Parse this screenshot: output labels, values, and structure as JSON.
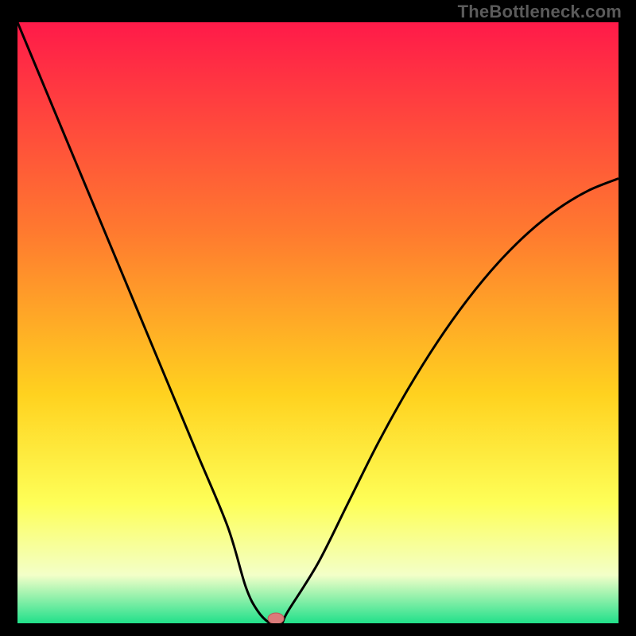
{
  "watermark": "TheBottleneck.com",
  "colors": {
    "frame_bg": "#000000",
    "curve": "#000000",
    "marker_fill": "#da7b7a",
    "marker_stroke": "#b85a59",
    "grad_top": "#ff1a49",
    "grad_mid1": "#ff6a2f",
    "grad_mid2": "#ffd21f",
    "grad_mid3": "#feff58",
    "grad_mid4": "#f6ffb0",
    "grad_bottom": "#21e08a"
  },
  "chart_data": {
    "type": "line",
    "title": "",
    "xlabel": "",
    "ylabel": "",
    "xlim": [
      0,
      100
    ],
    "ylim": [
      0,
      100
    ],
    "annotations": [],
    "series": [
      {
        "name": "bottleneck-curve",
        "x": [
          0,
          5,
          10,
          15,
          20,
          25,
          30,
          35,
          38,
          40,
          42,
          43,
          44,
          45,
          50,
          55,
          60,
          65,
          70,
          75,
          80,
          85,
          90,
          95,
          100
        ],
        "y": [
          100,
          88,
          76,
          64,
          52,
          40,
          28,
          16,
          6,
          2,
          0,
          0,
          0,
          2,
          10,
          20,
          30,
          39,
          47,
          54,
          60,
          65,
          69,
          72,
          74
        ]
      }
    ],
    "marker": {
      "x": 43,
      "y": 0
    },
    "background_gradient_stops": [
      {
        "offset": 0,
        "color": "#ff1a49"
      },
      {
        "offset": 35,
        "color": "#ff7a2f"
      },
      {
        "offset": 62,
        "color": "#ffd21f"
      },
      {
        "offset": 80,
        "color": "#feff58"
      },
      {
        "offset": 92,
        "color": "#f3ffc8"
      },
      {
        "offset": 100,
        "color": "#21e08a"
      }
    ]
  }
}
